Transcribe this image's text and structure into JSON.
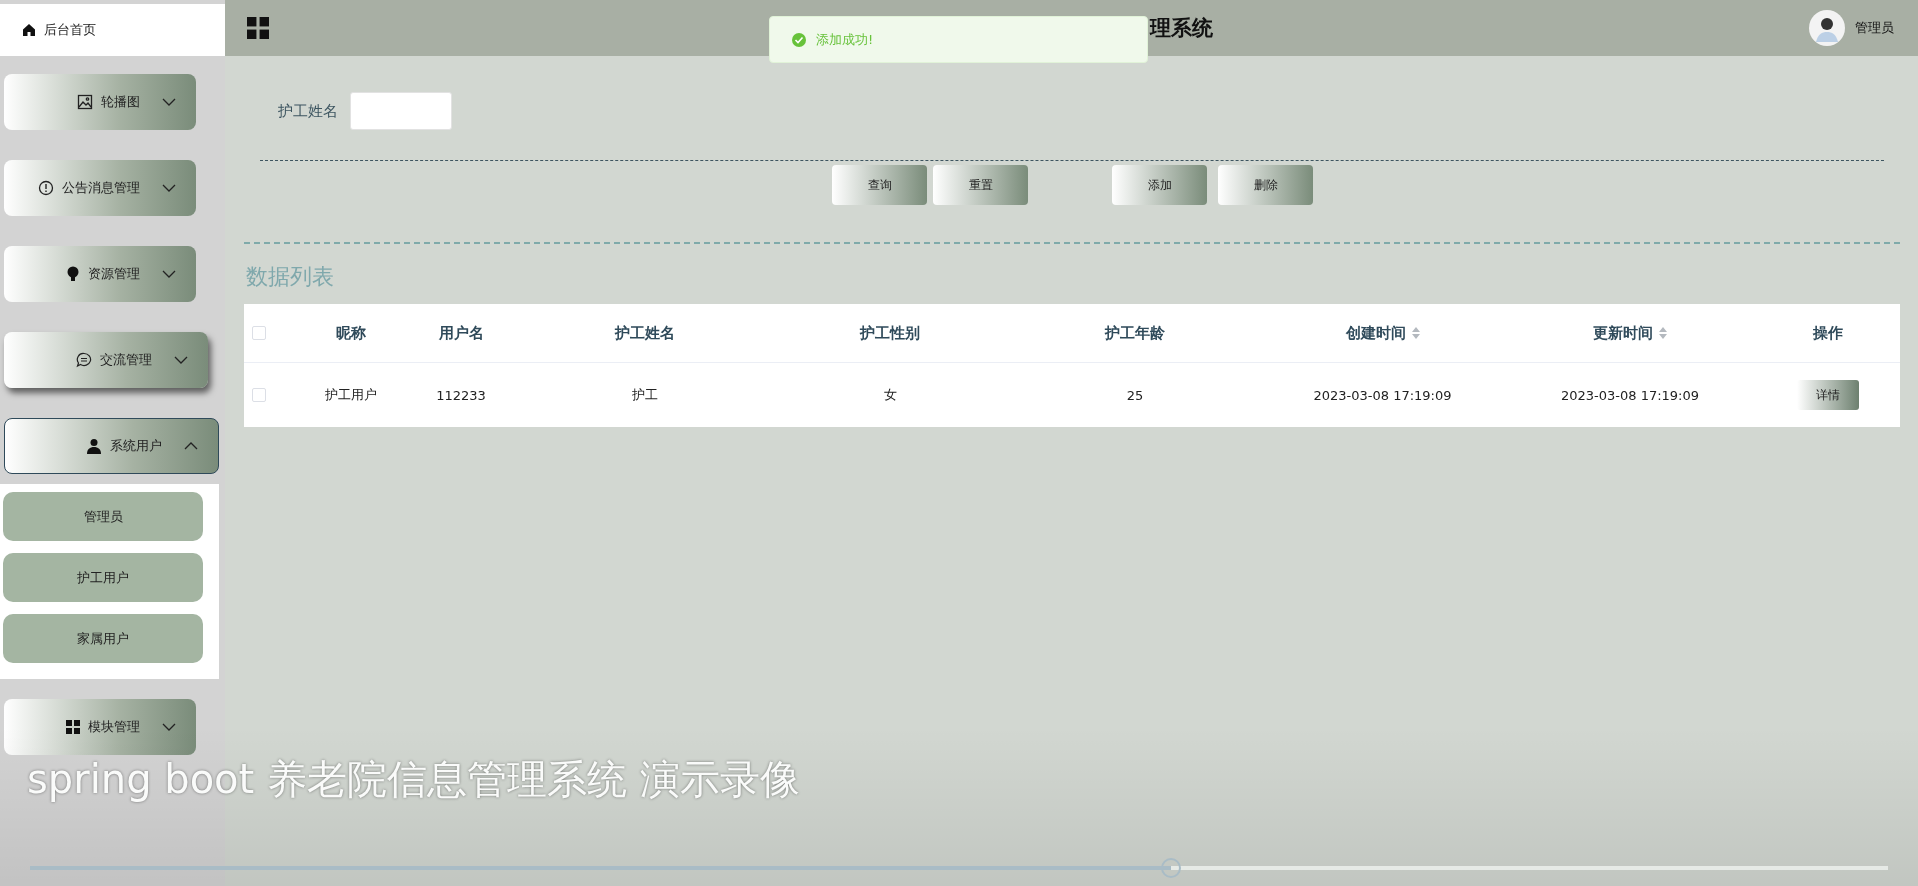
{
  "sidebar": {
    "home": "后台首页",
    "items": [
      {
        "label": "轮播图",
        "expanded": false,
        "hovered": false
      },
      {
        "label": "公告消息管理",
        "expanded": false,
        "hovered": false
      },
      {
        "label": "资源管理",
        "expanded": false,
        "hovered": false
      },
      {
        "label": "交流管理",
        "expanded": false,
        "hovered": true
      },
      {
        "label": "系统用户",
        "expanded": true,
        "hovered": false,
        "children": [
          {
            "label": "管理员"
          },
          {
            "label": "护工用户"
          },
          {
            "label": "家属用户"
          }
        ]
      },
      {
        "label": "模块管理",
        "expanded": false,
        "hovered": false
      }
    ]
  },
  "header": {
    "title": "理系统",
    "user": "管理员"
  },
  "toast": {
    "message": "添加成功!"
  },
  "search": {
    "label": "护工姓名"
  },
  "buttons": [
    "查询",
    "重置",
    "添加",
    "删除"
  ],
  "section_title": "数据列表",
  "table": {
    "columns": [
      {
        "label": "昵称",
        "sortable": false
      },
      {
        "label": "用户名",
        "sortable": false
      },
      {
        "label": "护工姓名",
        "sortable": false
      },
      {
        "label": "护工性别",
        "sortable": false
      },
      {
        "label": "护工年龄",
        "sortable": false
      },
      {
        "label": "创建时间",
        "sortable": true
      },
      {
        "label": "更新时间",
        "sortable": true
      },
      {
        "label": "操作",
        "sortable": false
      }
    ],
    "header_checked": false,
    "rows": [
      {
        "checked": false,
        "cells": [
          "护工用户",
          "112233",
          "护工",
          "女",
          "25",
          "2023-03-08 17:19:09",
          "2023-03-08 17:19:09"
        ],
        "action": "详情"
      }
    ]
  },
  "video": {
    "caption": "spring boot 养老院信息管理系统 演示录像",
    "progress": {
      "level": 0.614
    }
  }
}
